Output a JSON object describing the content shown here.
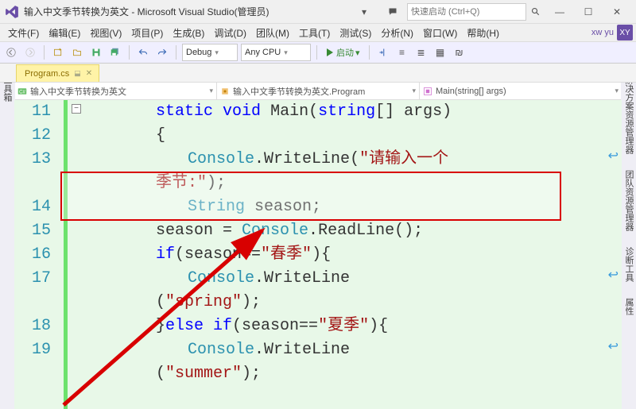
{
  "title": "输入中文季节转换为英文 - Microsoft Visual Studio(管理员)",
  "quick_launch_placeholder": "快速启动 (Ctrl+Q)",
  "username": "xw yu",
  "user_tile": "XY",
  "menu": {
    "file": "文件(F)",
    "edit": "编辑(E)",
    "view": "视图(V)",
    "project": "项目(P)",
    "build": "生成(B)",
    "debug": "调试(D)",
    "team": "团队(M)",
    "tools": "工具(T)",
    "test": "测试(S)",
    "analyze": "分析(N)",
    "window": "窗口(W)",
    "help": "帮助(H)"
  },
  "toolbar": {
    "config": "Debug",
    "platform": "Any CPU",
    "start": "启动"
  },
  "tab": {
    "name": "Program.cs"
  },
  "nav": {
    "proj": "输入中文季节转换为英文",
    "cls": "输入中文季节转换为英文.Program",
    "fn": "Main(string[] args)"
  },
  "rails": {
    "left": "工具箱",
    "right": [
      "解决方案资源管理器",
      "团队资源管理器",
      "诊断工具",
      "属性"
    ]
  },
  "code": {
    "l11": {
      "n": "11",
      "kw1": "static",
      "kw2": "void",
      "fn": "Main",
      "br": "(",
      "kw3": "string",
      "arr": "[]",
      " id": " args",
      ")": ")"
    },
    "l12": {
      "n": "12",
      "txt": "{"
    },
    "l13": {
      "n": "13",
      "c": "Console",
      "d": ".",
      "m": "WriteLine",
      "open": "(",
      "s": "\"请输入一个",
      "cont": "季节:\"",
      "close": ");"
    },
    "l14": {
      "n": "14",
      "t": "String",
      "sp": " ",
      "v": "season",
      ";": ";"
    },
    "l15": {
      "n": "15",
      "v": "season = ",
      "c": "Console",
      "d": ".",
      "m": "ReadLine",
      "call": "();"
    },
    "l16": {
      "n": "16",
      "kw": "if",
      "open": "(season==",
      "s": "\"春季\"",
      "close": "){"
    },
    "l17": {
      "n": "17",
      "c": "Console",
      "d": ".",
      "m": "WriteLine",
      "cont_open": "(",
      "s": "\"spring\"",
      "close": ");"
    },
    "l18": {
      "n": "18",
      "br": "}",
      "kw": "else if",
      "open": "(season==",
      "s": "\"夏季\"",
      "close": "){"
    },
    "l19": {
      "n": "19",
      "c": "Console",
      "d": ".",
      "m": "WriteLine",
      "cont_open": "(",
      "s": "\"summer\"",
      "close": ");"
    }
  }
}
